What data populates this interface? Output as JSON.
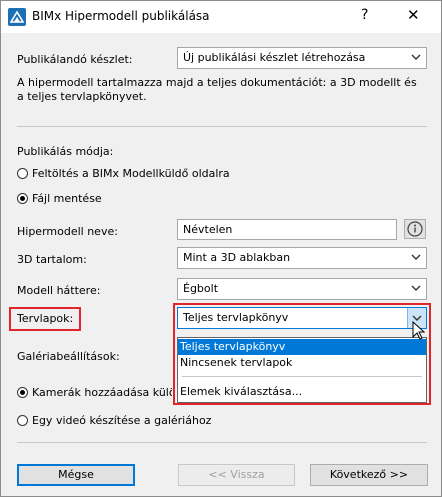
{
  "window": {
    "title": "BIMx Hipermodell publikálása",
    "help": "?",
    "close": "✕"
  },
  "content_set": {
    "label": "Publikálandó készlet:",
    "value": "Új publikálási készlet létrehozása"
  },
  "description": "A hipermodell tartalmazza majd a teljes dokumentációt: a 3D modellt és a teljes tervlapkönyvet.",
  "publish_mode": {
    "heading": "Publikálás módja:",
    "options": [
      {
        "label": "Feltöltés a BIMx Modellküldő oldalra",
        "selected": false
      },
      {
        "label": "Fájl mentése",
        "selected": true
      }
    ]
  },
  "hypermodel_name": {
    "label": "Hipermodell neve:",
    "value": "Névtelen"
  },
  "content_3d": {
    "label": "3D tartalom:",
    "value": "Mint a 3D ablakban"
  },
  "background": {
    "label": "Modell háttere:",
    "value": "Égbolt"
  },
  "layouts": {
    "label": "Tervlapok:",
    "value": "Teljes tervlapkönyv",
    "options": [
      "Teljes tervlapkönyv",
      "Nincsenek tervlapok",
      "Elemek kiválasztása..."
    ],
    "highlight_color": "#e0262a"
  },
  "gallery": {
    "heading": "Galériabeállítások:",
    "options": [
      {
        "label": "Kamerák hozzáadása különa",
        "selected": true
      },
      {
        "label": "Egy videó készítése a galériához",
        "selected": false
      }
    ]
  },
  "buttons": {
    "cancel": "Mégse",
    "back": "<< Vissza",
    "next": "Következő >>"
  }
}
